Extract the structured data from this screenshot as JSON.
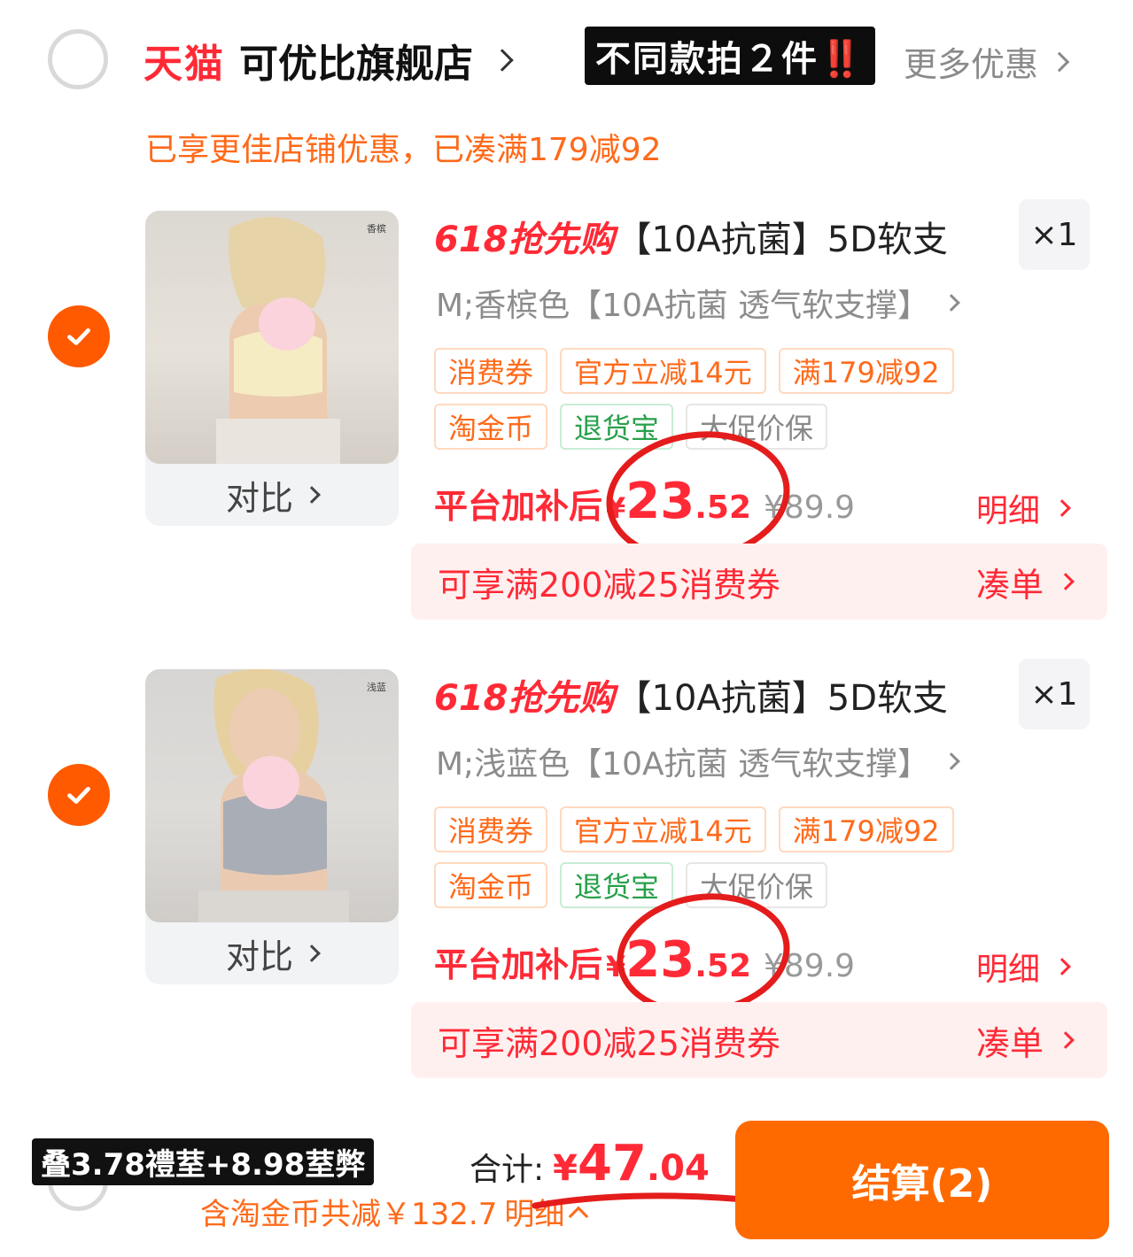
{
  "store": {
    "platform": "天猫",
    "name": "可优比旗舰店",
    "promo_tag_text": "不同款拍２件",
    "promo_tag_emoji": "‼️",
    "more_deals": "更多优惠",
    "shop_promo": "已享更佳店铺优惠，已凑满179减92"
  },
  "items": [
    {
      "badge": "618抢先购",
      "title": "【10A抗菌】5D软支",
      "quantity": "×1",
      "sku": "M;香槟色【10A抗菌 透气软支撑】",
      "image_label": "香槟",
      "compare": "对比",
      "tags": [
        {
          "text": "消费券",
          "style": "orange"
        },
        {
          "text": "官方立减14元",
          "style": "orange"
        },
        {
          "text": "满179减92",
          "style": "orange"
        },
        {
          "text": "淘金币",
          "style": "orange"
        },
        {
          "text": "退货宝",
          "style": "green"
        },
        {
          "text": "大促价保",
          "style": "gray"
        }
      ],
      "price_label": "平台加补后",
      "currency": "¥",
      "price_int": "23",
      "price_dec": ".52",
      "original_price": "¥89.9",
      "detail": "明细",
      "coupon_text": "可享满200减25消费券",
      "coupon_action": "凑单"
    },
    {
      "badge": "618抢先购",
      "title": "【10A抗菌】5D软支",
      "quantity": "×1",
      "sku": "M;浅蓝色【10A抗菌 透气软支撑】",
      "image_label": "浅蓝",
      "compare": "对比",
      "tags": [
        {
          "text": "消费券",
          "style": "orange"
        },
        {
          "text": "官方立减14元",
          "style": "orange"
        },
        {
          "text": "满179减92",
          "style": "orange"
        },
        {
          "text": "淘金币",
          "style": "orange"
        },
        {
          "text": "退货宝",
          "style": "green"
        },
        {
          "text": "大促价保",
          "style": "gray"
        }
      ],
      "price_label": "平台加补后",
      "currency": "¥",
      "price_int": "23",
      "price_dec": ".52",
      "original_price": "¥89.9",
      "detail": "明细",
      "coupon_text": "可享满200减25消费券",
      "coupon_action": "凑单"
    }
  ],
  "footer": {
    "overlay_note": "叠3.78禮荎+8.98荎弊",
    "total_label": "合计:",
    "currency": "¥",
    "total_int": "47",
    "total_dec": ".04",
    "saved_text": "含淘金币共减￥132.7",
    "detail_label": "明细",
    "checkout_label": "结算(2)"
  },
  "colors": {
    "accent_red": "#ff2a36",
    "accent_orange": "#ff6a00",
    "annotation_red": "#e41c1c"
  }
}
